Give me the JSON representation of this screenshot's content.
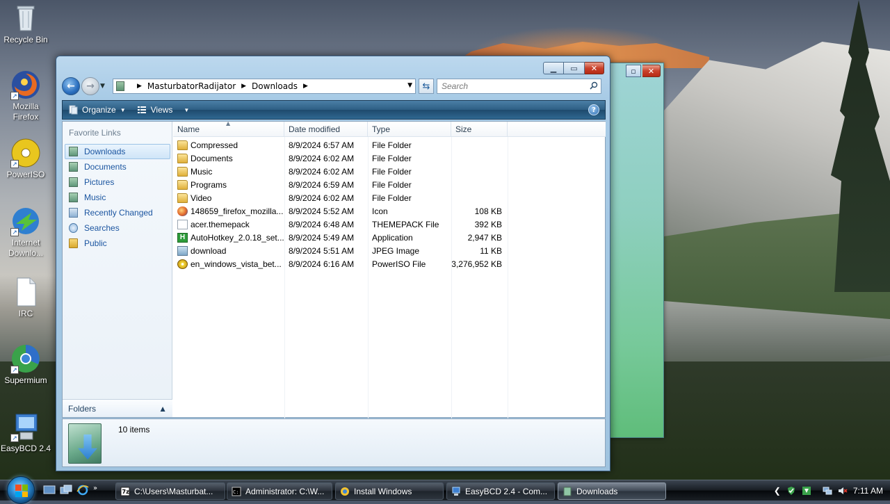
{
  "desktop": {
    "icons": [
      {
        "label": "Recycle Bin",
        "icon": "recycle-bin-icon"
      },
      {
        "label": "Mozilla Firefox",
        "icon": "firefox-icon"
      },
      {
        "label": "PowerISO",
        "icon": "poweriso-icon"
      },
      {
        "label": "Internet Downlo...",
        "icon": "internet-download-manager-icon"
      },
      {
        "label": "IRC",
        "icon": "document-icon"
      },
      {
        "label": "Supermium",
        "icon": "supermium-icon"
      },
      {
        "label": "EasyBCD 2.4",
        "icon": "easybcd-icon"
      }
    ]
  },
  "window": {
    "breadcrumb": [
      "MasturbatorRadijator",
      "Downloads"
    ],
    "search_placeholder": "Search",
    "toolbar": {
      "organize": "Organize",
      "views": "Views"
    },
    "sidebar": {
      "favorite_title": "Favorite Links",
      "items": [
        "Downloads",
        "Documents",
        "Pictures",
        "Music",
        "Recently Changed",
        "Searches",
        "Public"
      ],
      "selected_index": 0,
      "folders_label": "Folders"
    },
    "columns": [
      "Name",
      "Date modified",
      "Type",
      "Size"
    ],
    "files": [
      {
        "name": "Compressed",
        "date": "8/9/2024 6:57 AM",
        "type": "File Folder",
        "size": "",
        "icon": "folder"
      },
      {
        "name": "Documents",
        "date": "8/9/2024 6:02 AM",
        "type": "File Folder",
        "size": "",
        "icon": "folder"
      },
      {
        "name": "Music",
        "date": "8/9/2024 6:02 AM",
        "type": "File Folder",
        "size": "",
        "icon": "folder"
      },
      {
        "name": "Programs",
        "date": "8/9/2024 6:59 AM",
        "type": "File Folder",
        "size": "",
        "icon": "folder"
      },
      {
        "name": "Video",
        "date": "8/9/2024 6:02 AM",
        "type": "File Folder",
        "size": "",
        "icon": "folder"
      },
      {
        "name": "148659_firefox_mozilla...",
        "date": "8/9/2024 5:52 AM",
        "type": "Icon",
        "size": "108 KB",
        "icon": "firefox"
      },
      {
        "name": "acer.themepack",
        "date": "8/9/2024 6:48 AM",
        "type": "THEMEPACK File",
        "size": "392 KB",
        "icon": "doc"
      },
      {
        "name": "AutoHotkey_2.0.18_set...",
        "date": "8/9/2024 5:49 AM",
        "type": "Application",
        "size": "2,947 KB",
        "icon": "ahk"
      },
      {
        "name": "download",
        "date": "8/9/2024 5:51 AM",
        "type": "JPEG Image",
        "size": "11 KB",
        "icon": "img"
      },
      {
        "name": "en_windows_vista_bet...",
        "date": "8/9/2024 6:16 AM",
        "type": "PowerISO File",
        "size": "3,276,952 KB",
        "icon": "iso"
      }
    ],
    "details": {
      "item_count": "10 items"
    }
  },
  "taskbar": {
    "buttons": [
      {
        "label": "C:\\Users\\Masturbat...",
        "icon": "7zip-icon",
        "active": false
      },
      {
        "label": "Administrator: C:\\W...",
        "icon": "cmd-icon",
        "active": false
      },
      {
        "label": "Install Windows",
        "icon": "install-windows-icon",
        "active": false
      },
      {
        "label": "EasyBCD 2.4 - Com...",
        "icon": "easybcd-icon",
        "active": false
      },
      {
        "label": "Downloads",
        "icon": "explorer-folder-icon",
        "active": true
      }
    ],
    "clock": "7:11 AM"
  },
  "colors": {
    "link": "#1b55a0",
    "toolbar": "#2d5e84"
  }
}
